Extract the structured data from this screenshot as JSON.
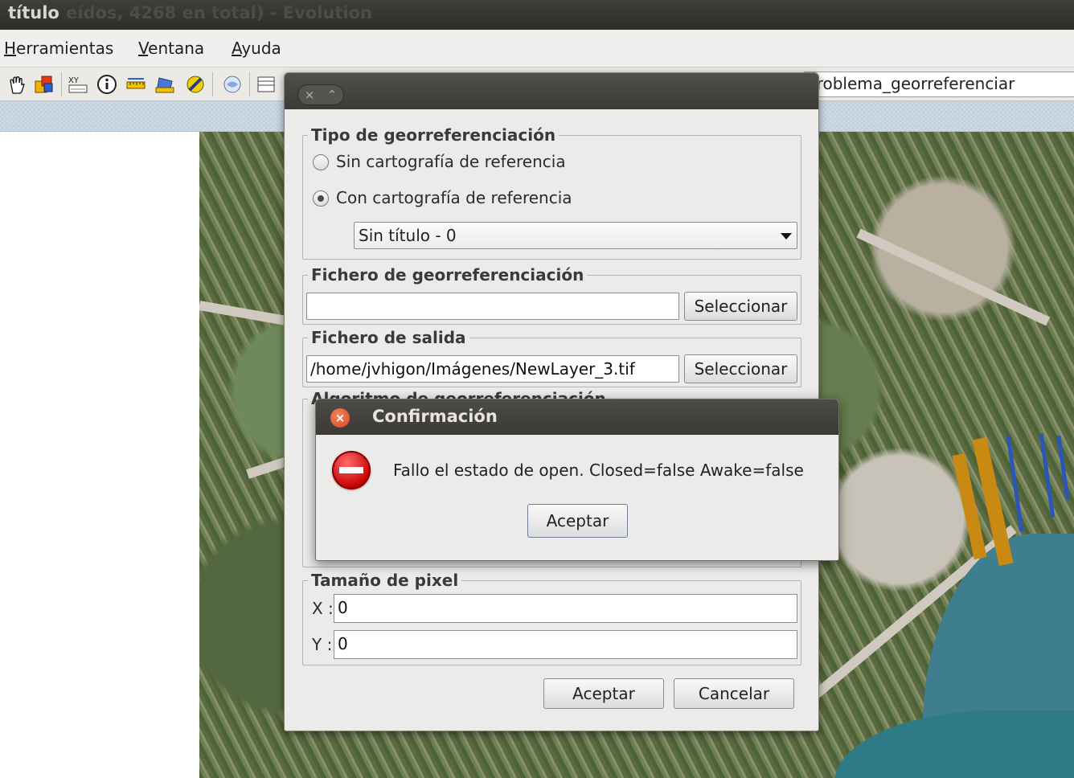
{
  "window": {
    "title": "título",
    "background_title": "eídos, 4268 en total) - Evolution"
  },
  "menubar": {
    "items": [
      {
        "label": "Herramientas",
        "mnemonic": "H",
        "rest": "erramientas"
      },
      {
        "label": "Ventana",
        "mnemonic": "V",
        "rest": "entana"
      },
      {
        "label": "Ayuda",
        "mnemonic": "A",
        "rest": "yuda"
      }
    ]
  },
  "toolbar": {
    "icons": [
      "hand-pan-icon",
      "layer-properties-icon",
      "coordinates-icon",
      "info-icon",
      "measure-distance-icon",
      "measure-area-icon",
      "georeference-icon",
      "locator-icon",
      "table-icon",
      "zoom-in-icon",
      "zoom-out-icon",
      "full-extent-icon",
      "zoom-select-icon",
      "pan-arrows-icon",
      "globe-icon",
      "search-layer-icon"
    ],
    "layer_name": "problema_georreferenciar"
  },
  "georef_dialog": {
    "type_group": {
      "legend": "Tipo de georreferenciación",
      "option_no_ref": "Sin cartografía de referencia",
      "option_with_ref": "Con cartografía de referencia",
      "selected_view": "Sin título - 0"
    },
    "georef_file_group": {
      "legend": "Fichero de georreferenciación",
      "value": "",
      "button": "Seleccionar"
    },
    "output_file_group": {
      "legend": "Fichero de salida",
      "value": "/home/jvhigon/Imágenes/NewLayer_3.tif",
      "button": "Seleccionar"
    },
    "algorithm_group": {
      "legend": "Algoritmo de georreferenciación"
    },
    "pixel_size_group": {
      "legend": "Tamaño de pixel",
      "x_label": "X :",
      "x_value": "0",
      "y_label": "Y :",
      "y_value": "0"
    },
    "accept_button": "Aceptar",
    "cancel_button": "Cancelar"
  },
  "confirm_dialog": {
    "title": "Confirmación",
    "message": "Fallo el estado de open. Closed=false Awake=false",
    "accept_button": "Aceptar"
  },
  "colors": {
    "titlebar": "#3c3b37",
    "pier": "#c88a12",
    "dock": "#2b56b8",
    "sea": "#3f7e8f",
    "error_red": "#c40000"
  }
}
